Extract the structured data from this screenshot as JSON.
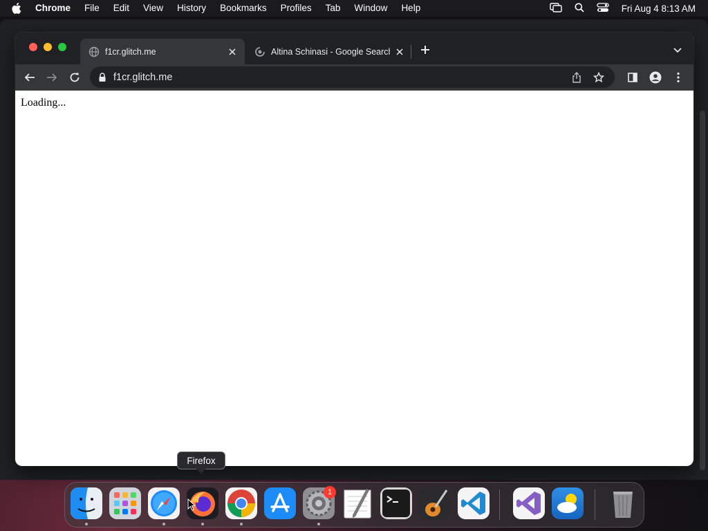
{
  "menubar": {
    "apple_icon": "apple-icon",
    "app_name": "Chrome",
    "items": [
      "File",
      "Edit",
      "View",
      "History",
      "Bookmarks",
      "Profiles",
      "Tab",
      "Window",
      "Help"
    ],
    "status_icons": [
      "screen-mirroring-icon",
      "spotlight-search-icon",
      "control-center-icon"
    ],
    "clock": "Fri Aug 4  8:13 AM"
  },
  "browser": {
    "tabs": [
      {
        "title": "f1cr.glitch.me",
        "active": true,
        "favicon": "globe-icon"
      },
      {
        "title": "Altina Schinasi - Google Search",
        "active": false,
        "favicon": "google-loading-icon"
      }
    ],
    "new_tab_icon": "plus-icon",
    "tab_search_icon": "chevron-down-icon",
    "toolbar": {
      "back_icon": "back-arrow-icon",
      "forward_icon": "forward-arrow-icon",
      "reload_icon": "reload-icon",
      "url": "f1cr.glitch.me",
      "share_icon": "share-icon",
      "bookmark_icon": "star-icon",
      "side_panel_icon": "side-panel-icon",
      "profile_icon": "profile-icon",
      "menu_icon": "kebab-menu-icon"
    },
    "page": {
      "text": "Loading..."
    }
  },
  "dock": {
    "tooltip": "Firefox",
    "apps": [
      {
        "name": "Finder",
        "icon": "finder-icon",
        "running": true
      },
      {
        "name": "Launchpad",
        "icon": "launchpad-icon",
        "running": false
      },
      {
        "name": "Safari",
        "icon": "safari-icon",
        "running": true
      },
      {
        "name": "Firefox",
        "icon": "firefox-icon",
        "running": true
      },
      {
        "name": "Chrome",
        "icon": "chrome-icon",
        "running": true
      },
      {
        "name": "App Store",
        "icon": "app-store-icon",
        "running": false
      },
      {
        "name": "System Settings",
        "icon": "system-settings-icon",
        "running": true,
        "badge": "1"
      },
      {
        "name": "TextEdit",
        "icon": "textedit-icon",
        "running": false
      },
      {
        "name": "Terminal",
        "icon": "terminal-icon",
        "running": false
      },
      {
        "name": "GarageBand",
        "icon": "garageband-icon",
        "running": false
      },
      {
        "name": "Visual Studio Code",
        "icon": "vscode-icon",
        "running": false
      },
      {
        "name": "Visual Studio",
        "icon": "visual-studio-icon",
        "running": false
      },
      {
        "name": "Weather",
        "icon": "weather-icon",
        "running": false
      },
      {
        "name": "Trash",
        "icon": "trash-icon",
        "running": false
      }
    ]
  },
  "colors": {
    "chrome_frame": "#202124",
    "chrome_toolbar": "#35363a",
    "close": "#ff5f57",
    "minimize": "#febc2e",
    "zoom": "#28c840",
    "badge": "#ff3b30"
  }
}
